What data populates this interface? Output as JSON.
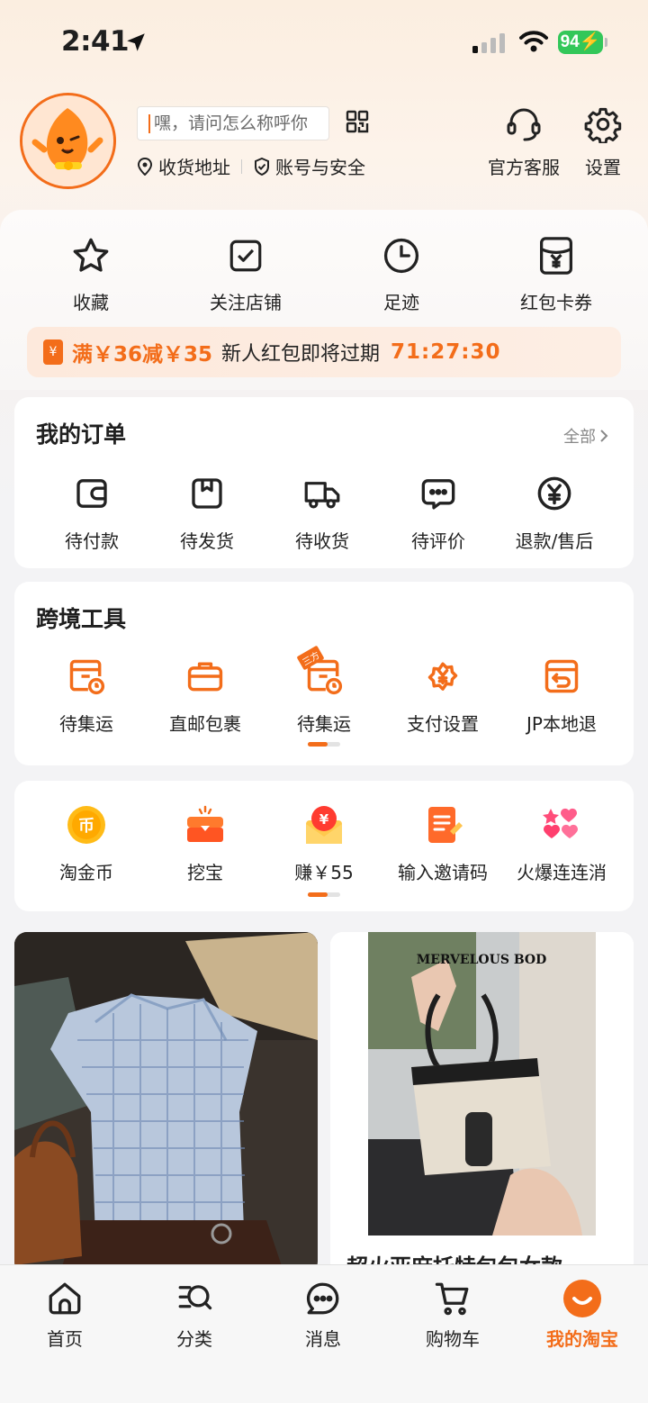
{
  "status_bar": {
    "time": "2:41",
    "battery": "94"
  },
  "profile": {
    "name_placeholder": "嘿，请问怎么称呼你",
    "address_label": "收货地址",
    "security_label": "账号与安全",
    "service_label": "官方客服",
    "settings_label": "设置"
  },
  "quick_actions": [
    {
      "label": "收藏",
      "icon": "star-icon"
    },
    {
      "label": "关注店铺",
      "icon": "follow-store-icon"
    },
    {
      "label": "足迹",
      "icon": "clock-icon"
    },
    {
      "label": "红包卡券",
      "icon": "coupon-icon"
    }
  ],
  "promo": {
    "amount": "满￥36减￥35",
    "text": "新人红包即将过期",
    "timer": "71:27:30"
  },
  "orders": {
    "title": "我的订单",
    "all_label": "全部",
    "items": [
      {
        "label": "待付款",
        "icon": "wallet-icon"
      },
      {
        "label": "待发货",
        "icon": "package-icon"
      },
      {
        "label": "待收货",
        "icon": "truck-icon"
      },
      {
        "label": "待评价",
        "icon": "chat-bubble-icon"
      },
      {
        "label": "退款/售后",
        "icon": "refund-icon"
      }
    ]
  },
  "cross_border": {
    "title": "跨境工具",
    "items": [
      {
        "label": "待集运",
        "icon": "consolidation-icon"
      },
      {
        "label": "直邮包裹",
        "icon": "briefcase-icon"
      },
      {
        "label": "待集运",
        "icon": "consolidation-icon",
        "badge": "三方"
      },
      {
        "label": "支付设置",
        "icon": "payment-settings-icon"
      },
      {
        "label": "JP本地退",
        "icon": "jp-return-icon"
      }
    ]
  },
  "services": {
    "items": [
      {
        "label": "淘金币",
        "icon": "gold-coin-icon",
        "glyph": "币"
      },
      {
        "label": "挖宝",
        "icon": "treasure-chest-icon"
      },
      {
        "label": "赚￥55",
        "icon": "red-envelope-icon",
        "glyph": "¥"
      },
      {
        "label": "输入邀请码",
        "icon": "invite-note-icon"
      },
      {
        "label": "火爆连连消",
        "icon": "hearts-game-icon"
      }
    ]
  },
  "feed": [
    {
      "title": "",
      "image": "plaid-shirt-outfit-photo"
    },
    {
      "title": "超火亚麻托特包包女款",
      "overlay_text": "MERVELOUS BOD",
      "image": "tote-bag-photo"
    }
  ],
  "tabbar": [
    {
      "label": "首页",
      "icon": "home-icon"
    },
    {
      "label": "分类",
      "icon": "category-search-icon"
    },
    {
      "label": "消息",
      "icon": "message-icon"
    },
    {
      "label": "购物车",
      "icon": "cart-icon"
    },
    {
      "label": "我的淘宝",
      "icon": "my-taobao-icon",
      "active": true
    }
  ],
  "colors": {
    "accent": "#f36d1a",
    "text": "#1f1f1f"
  }
}
